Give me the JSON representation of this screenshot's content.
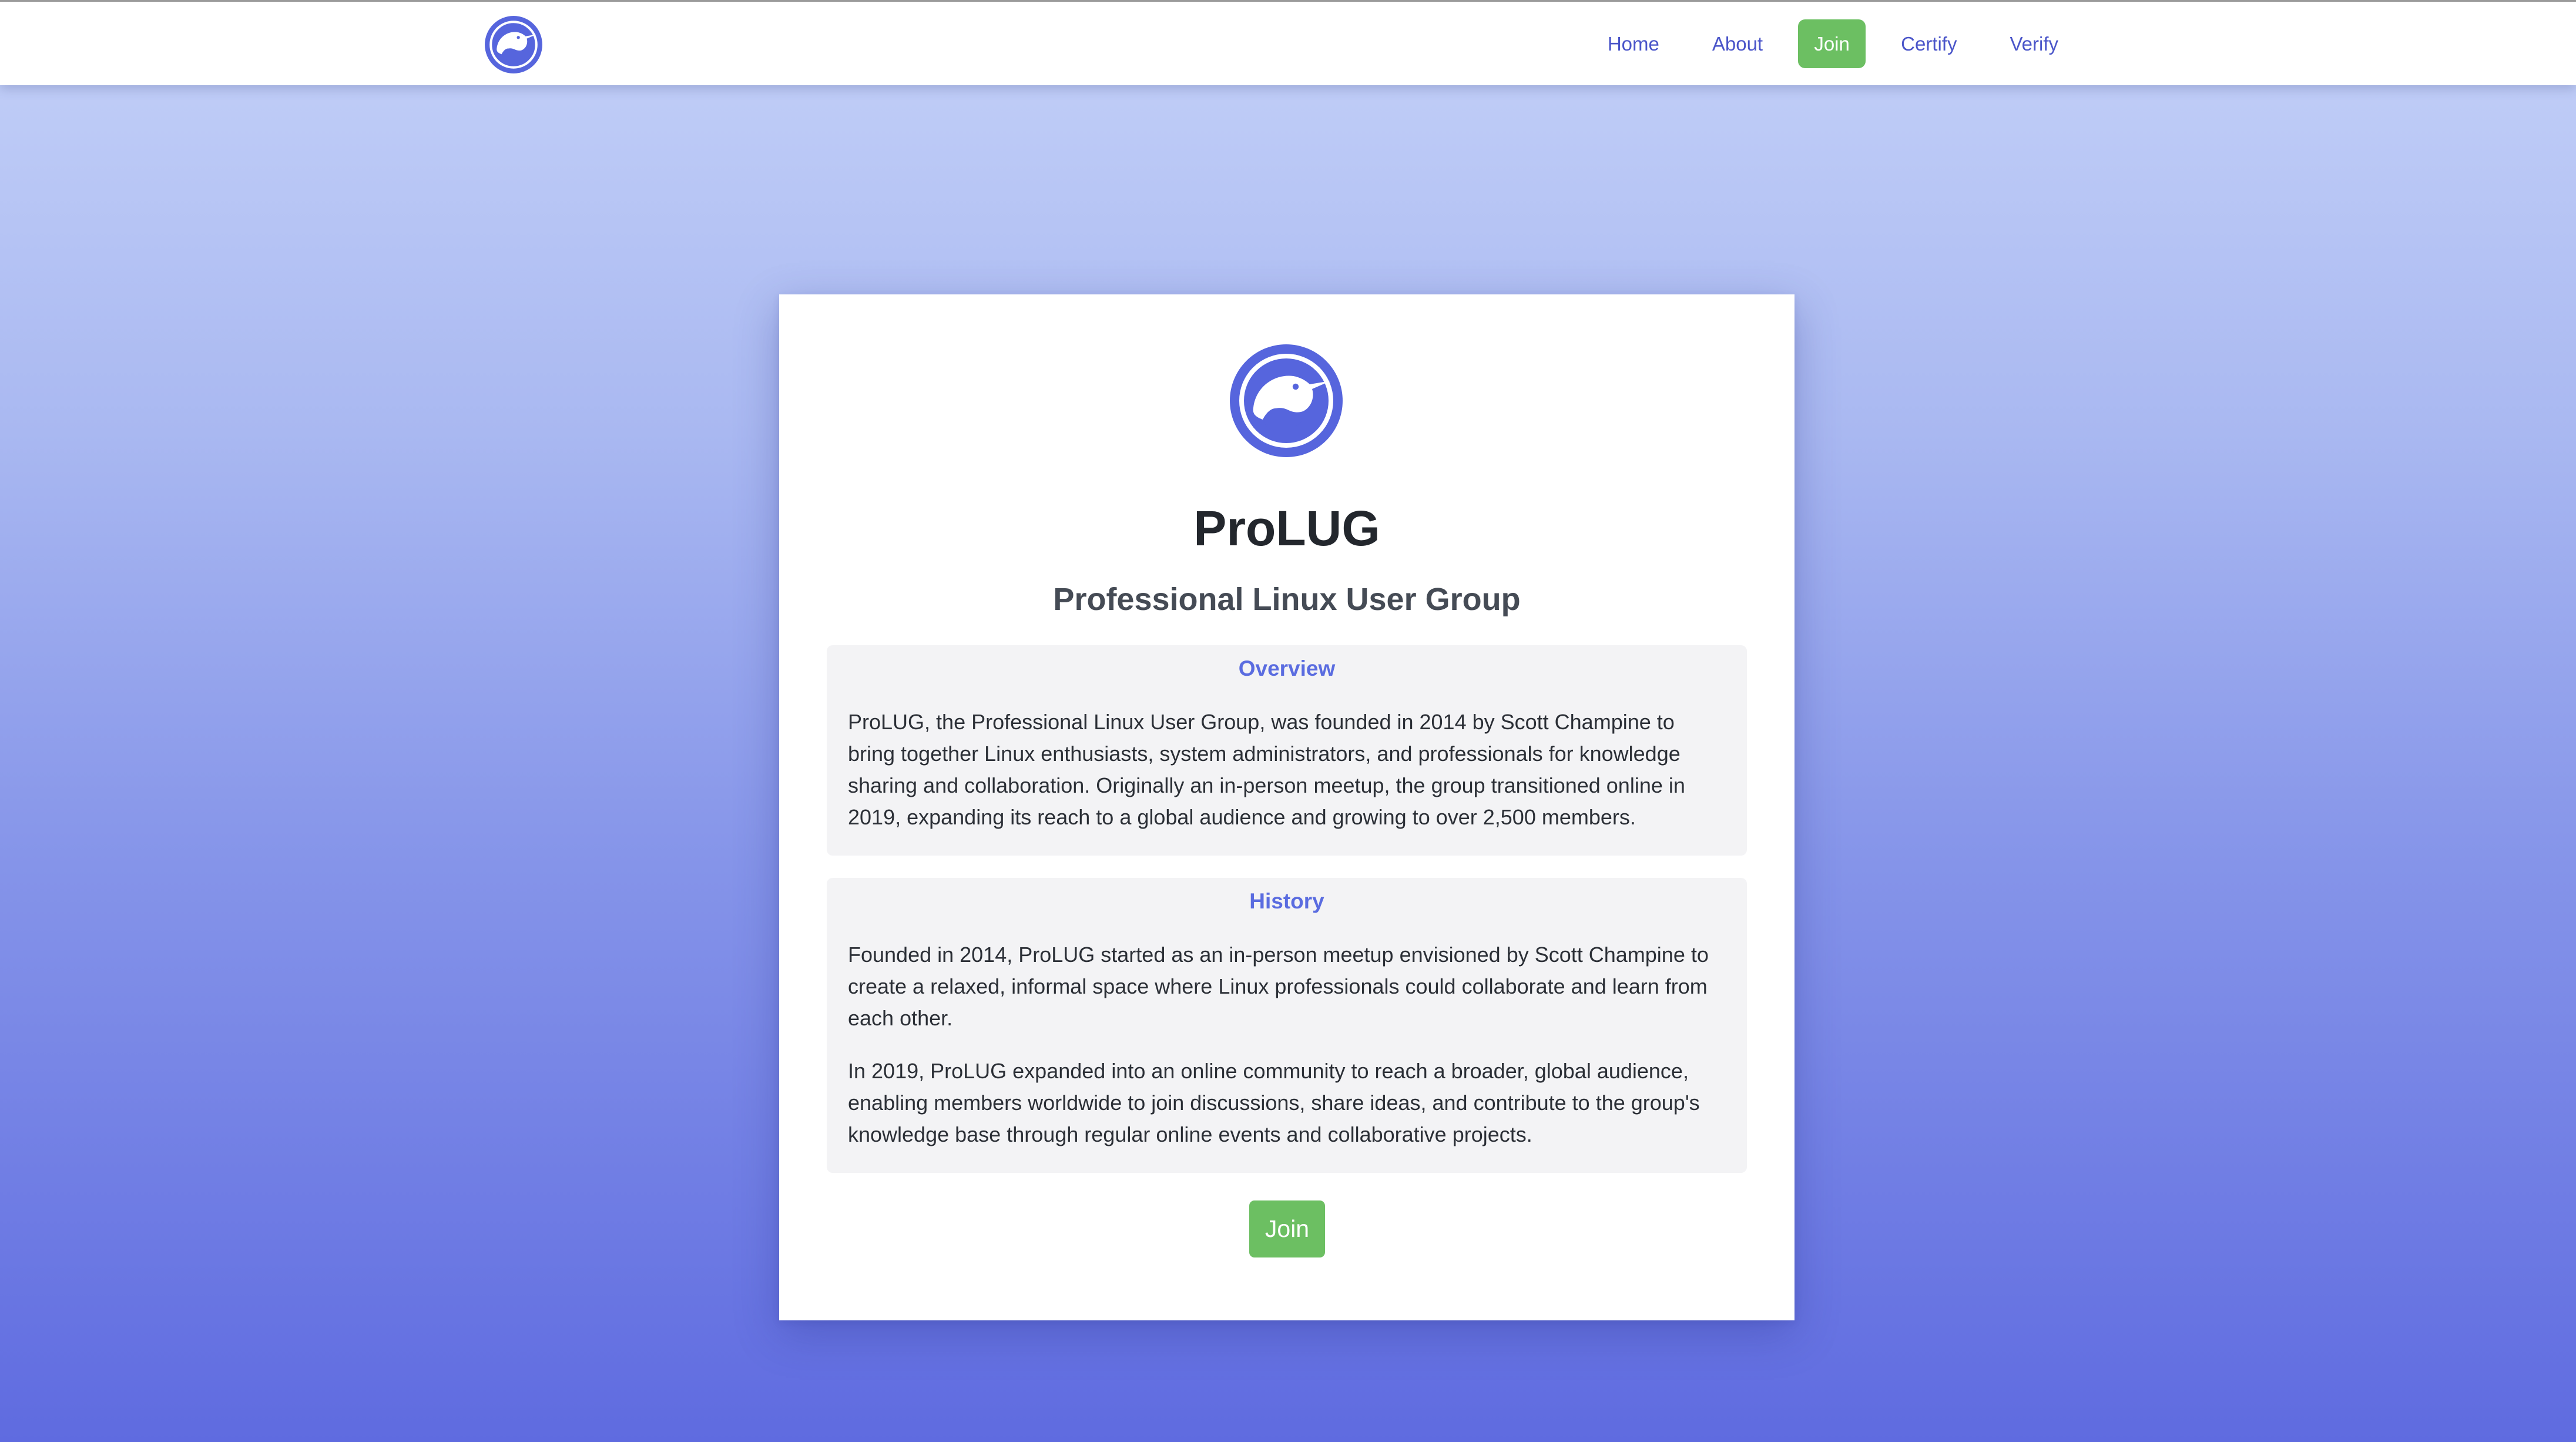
{
  "nav": {
    "logo_icon": "prolug-bird-logo-icon",
    "items": [
      {
        "label": "Home",
        "active": false
      },
      {
        "label": "About",
        "active": false
      },
      {
        "label": "Join",
        "active": true
      },
      {
        "label": "Certify",
        "active": false
      },
      {
        "label": "Verify",
        "active": false
      }
    ]
  },
  "header": {
    "title": "ProLUG",
    "subtitle": "Professional Linux User Group",
    "logo_icon": "prolug-bird-logo-icon"
  },
  "overview": {
    "heading": "Overview",
    "text": "ProLUG, the Professional Linux User Group, was founded in 2014 by Scott Champine to bring together Linux enthusiasts, system administrators, and professionals for knowledge sharing and collaboration. Originally an in-person meetup, the group transitioned online in 2019, expanding its reach to a global audience and growing to over 2,500 members."
  },
  "history": {
    "heading": "History",
    "paragraphs": [
      "Founded in 2014, ProLUG started as an in-person meetup envisioned by Scott Champine to create a relaxed, informal space where Linux professionals could collaborate and learn from each other.",
      "In 2019, ProLUG expanded into an online community to reach a broader, global audience, enabling members worldwide to join discussions, share ideas, and contribute to the group's knowledge base through regular online events and collaborative projects."
    ]
  },
  "join_button": {
    "label": "Join"
  },
  "colors": {
    "accent": "#5a6ce0",
    "nav_link": "#4a55c9",
    "active_button": "#6cbf62",
    "logo_blue": "#5665dd",
    "section_bg": "#f3f3f5"
  }
}
